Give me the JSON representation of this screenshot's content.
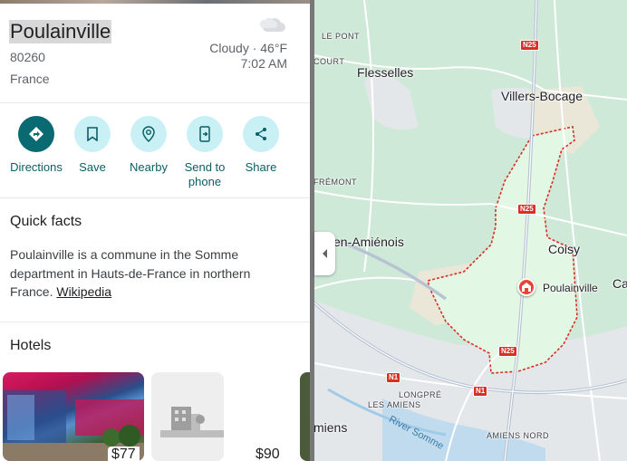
{
  "place": {
    "title": "Poulainville",
    "postcode": "80260",
    "country": "France"
  },
  "weather": {
    "summary": "Cloudy · 46°F",
    "time": "7:02 AM",
    "icon": "cloud-icon"
  },
  "actions": [
    {
      "label": "Directions",
      "icon": "directions-icon"
    },
    {
      "label": "Save",
      "icon": "bookmark-icon"
    },
    {
      "label": "Nearby",
      "icon": "nearby-icon"
    },
    {
      "label": "Send to phone",
      "label_line1": "Send to",
      "label_line2": "phone",
      "icon": "send-to-phone-icon"
    },
    {
      "label": "Share",
      "icon": "share-icon"
    }
  ],
  "quick_facts": {
    "title": "Quick facts",
    "text": "Poulainville is a commune in the Somme department in Hauts-de-France in northern France.",
    "text_line1": "Poulainville is a commune in the Somme",
    "text_line2": "department in Hauts-de-France in northern",
    "text_line3": "France.",
    "link": "Wikipedia"
  },
  "hotels": {
    "title": "Hotels",
    "items": [
      {
        "price": "$77"
      },
      {
        "price": "$90"
      }
    ]
  },
  "map": {
    "towns": [
      "Flesselles",
      "Villers-Bocage",
      "Coisy",
      "Cardonnette",
      "Amiens",
      "en-Amiénois"
    ],
    "town_flesselles": "Flesselles",
    "town_villers": "Villers-Bocage",
    "town_coisy": "Coisy",
    "town_ca": "Ca",
    "town_amiens": "miens",
    "town_amienois": "en-Amiénois",
    "hamlet_pont": "LE PONT",
    "hamlet_court": "COURT",
    "hamlet_fremont": "FRÉMONT",
    "hamlet_longpre_1": "LONGPRÉ",
    "hamlet_longpre_2": "LES AMIENS",
    "hamlet_amiens_nord": "AMIENS NORD",
    "river": "River Somme",
    "selected_place": "Poulainville",
    "roads": {
      "n25_a": "N25",
      "n25_b": "N25",
      "n25_c": "N25",
      "n1_a": "N1",
      "n1_b": "N1"
    },
    "colors": {
      "boundary": "#d93025",
      "land": "#cfe9d8",
      "highlight": "#e3f7e5"
    }
  }
}
